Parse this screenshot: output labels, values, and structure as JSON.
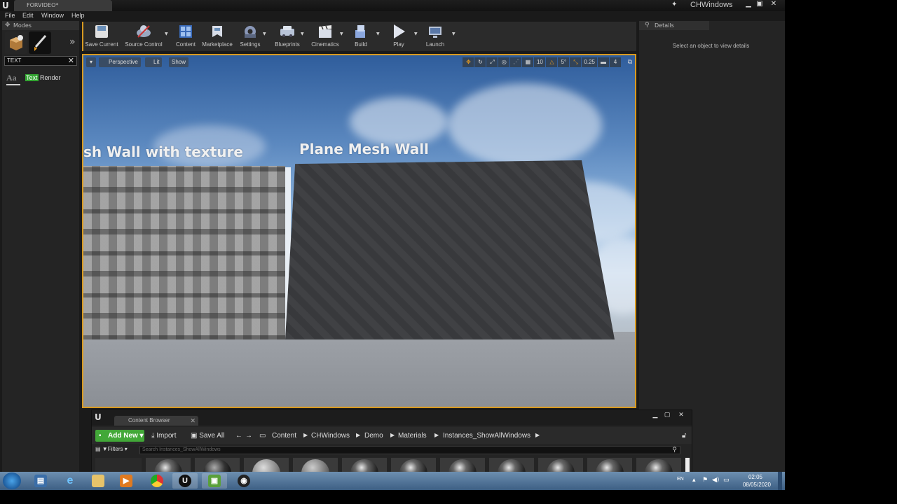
{
  "window": {
    "document_tab": "FORVIDEO*",
    "project_name": "CHWindows"
  },
  "menu": [
    "File",
    "Edit",
    "Window",
    "Help"
  ],
  "modes": {
    "tab_label": "Modes",
    "search_value": "TEXT",
    "result_highlight": "Text",
    "result_rest": " Render",
    "result_icon_text": "Aa"
  },
  "toolbar": {
    "items": [
      {
        "label": "Save Current",
        "icon": "save-icon"
      },
      {
        "label": "Source Control",
        "icon": "source-control-icon"
      },
      {
        "label": "Content",
        "icon": "content-icon"
      },
      {
        "label": "Marketplace",
        "icon": "marketplace-icon"
      },
      {
        "label": "Settings",
        "icon": "settings-icon"
      },
      {
        "label": "Blueprints",
        "icon": "blueprints-icon"
      },
      {
        "label": "Cinematics",
        "icon": "cinematics-icon"
      },
      {
        "label": "Build",
        "icon": "build-icon"
      },
      {
        "label": "Play",
        "icon": "play-icon"
      },
      {
        "label": "Launch",
        "icon": "launch-icon"
      }
    ]
  },
  "viewport": {
    "perspective_label": "Perspective",
    "lit_label": "Lit",
    "show_label": "Show",
    "grid_snap": "10",
    "rotation_snap": "5°",
    "scale_snap": "0.25",
    "camera_speed": "4",
    "wall_label_left": "sh Wall with texture",
    "wall_label_right": "Plane Mesh Wall"
  },
  "details": {
    "tab_label": "Details",
    "empty_message": "Select an object to view details"
  },
  "content_browser": {
    "tab_label": "Content Browser",
    "add_new": "Add New",
    "import": "Import",
    "save_all": "Save All",
    "breadcrumbs": [
      "Content",
      "CHWindows",
      "Demo",
      "Materials",
      "Instances_ShowAllWindows"
    ],
    "filters_label": "Filters",
    "search_placeholder": "Search Instances_ShowAllWindows"
  },
  "taskbar": {
    "language": "EN",
    "time": "02:05",
    "date": "08/05/2020",
    "apps": [
      "windows-explorer",
      "internet-explorer",
      "file-explorer",
      "media-player",
      "chrome",
      "unreal-engine",
      "minecraft",
      "obs"
    ]
  },
  "colors": {
    "accent_orange": "#d99a20",
    "add_new_green": "#42a838",
    "highlight_green": "#33a632"
  }
}
